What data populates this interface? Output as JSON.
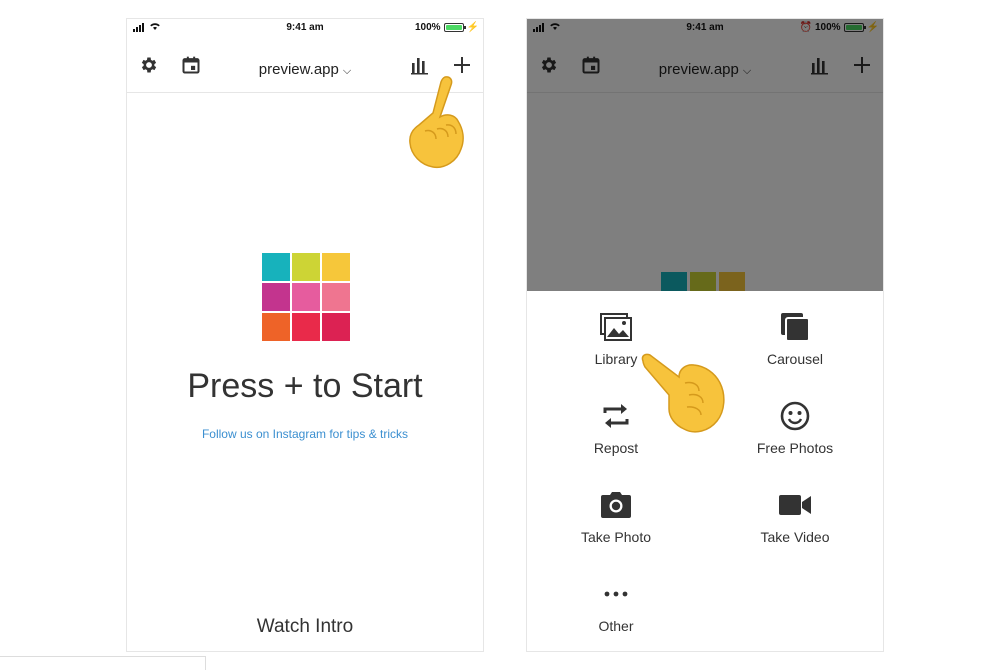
{
  "phone_left": {
    "status": {
      "time": "9:41 am",
      "battery": "100%"
    },
    "toolbar": {
      "title": "preview.app"
    },
    "grid_colors": [
      "#17b2bc",
      "#cdd435",
      "#f6c73a",
      "#c3348e",
      "#e65c9e",
      "#ef7590",
      "#ee6328",
      "#e92a4a",
      "#dc2253"
    ],
    "main": {
      "headline": "Press + to Start",
      "link": "Follow us on Instagram for tips & tricks",
      "footer": "Watch Intro"
    }
  },
  "phone_right": {
    "status": {
      "time": "9:41 am",
      "battery": "100%"
    },
    "toolbar": {
      "title": "preview.app"
    },
    "menu": {
      "library": "Library",
      "carousel": "Carousel",
      "repost": "Repost",
      "free_photos": "Free Photos",
      "take_photo": "Take Photo",
      "take_video": "Take Video",
      "other": "Other"
    }
  },
  "colors": {
    "accent_link": "#3b8fd0",
    "battery": "#4cd964"
  }
}
